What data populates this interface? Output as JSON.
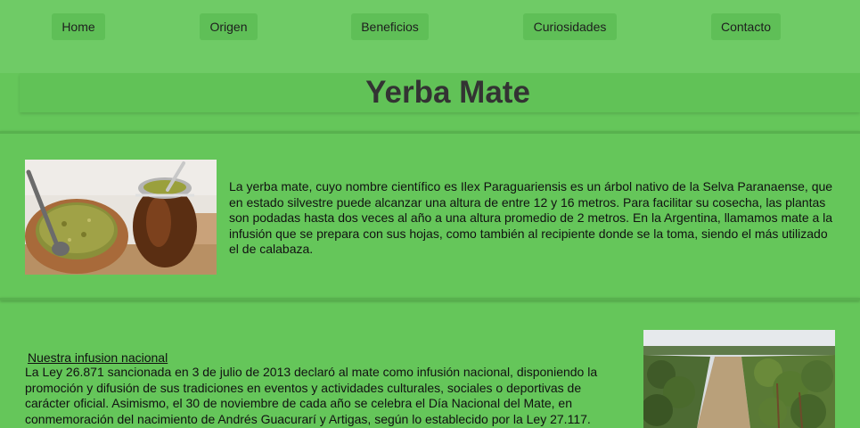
{
  "nav": {
    "items": [
      {
        "label": "Home"
      },
      {
        "label": "Origen"
      },
      {
        "label": "Beneficios"
      },
      {
        "label": "Curiosidades"
      },
      {
        "label": "Contacto"
      }
    ]
  },
  "header": {
    "title": "Yerba Mate"
  },
  "intro": {
    "text": "La yerba mate, cuyo nombre científico es Ilex Paraguariensis es un árbol nativo de la Selva Paranaense, que en estado silvestre puede alcanzar una altura de entre 12 y 16 metros. Para facilitar su cosecha, las plantas son podadas hasta dos veces al año a una altura promedio de 2 metros. En la Argentina, llamamos mate a la infusión que se prepara con sus hojas, como también al recipiente donde se la toma, siendo el más utilizado el de calabaza."
  },
  "law_section": {
    "heading": "Nuestra infusion nacional",
    "text": "La Ley 26.871 sancionada en 3 de julio de 2013 declaró al mate como infusión nacional, disponiendo la promoción y difusión de sus tradiciones en eventos y actividades culturales, sociales o deportivas de carácter oficial. Asimismo, el 30 de noviembre de cada año se celebra el Día Nacional del Mate, en conmemoración del nacimiento de Andrés Guacurarí y Artigas, según lo establecido por la Ley 27.117."
  },
  "colors": {
    "page_bg": "#65c65a",
    "nav_bg": "#6fcb66",
    "nav_item_bg": "#5fbf57",
    "title_color": "#333333"
  }
}
